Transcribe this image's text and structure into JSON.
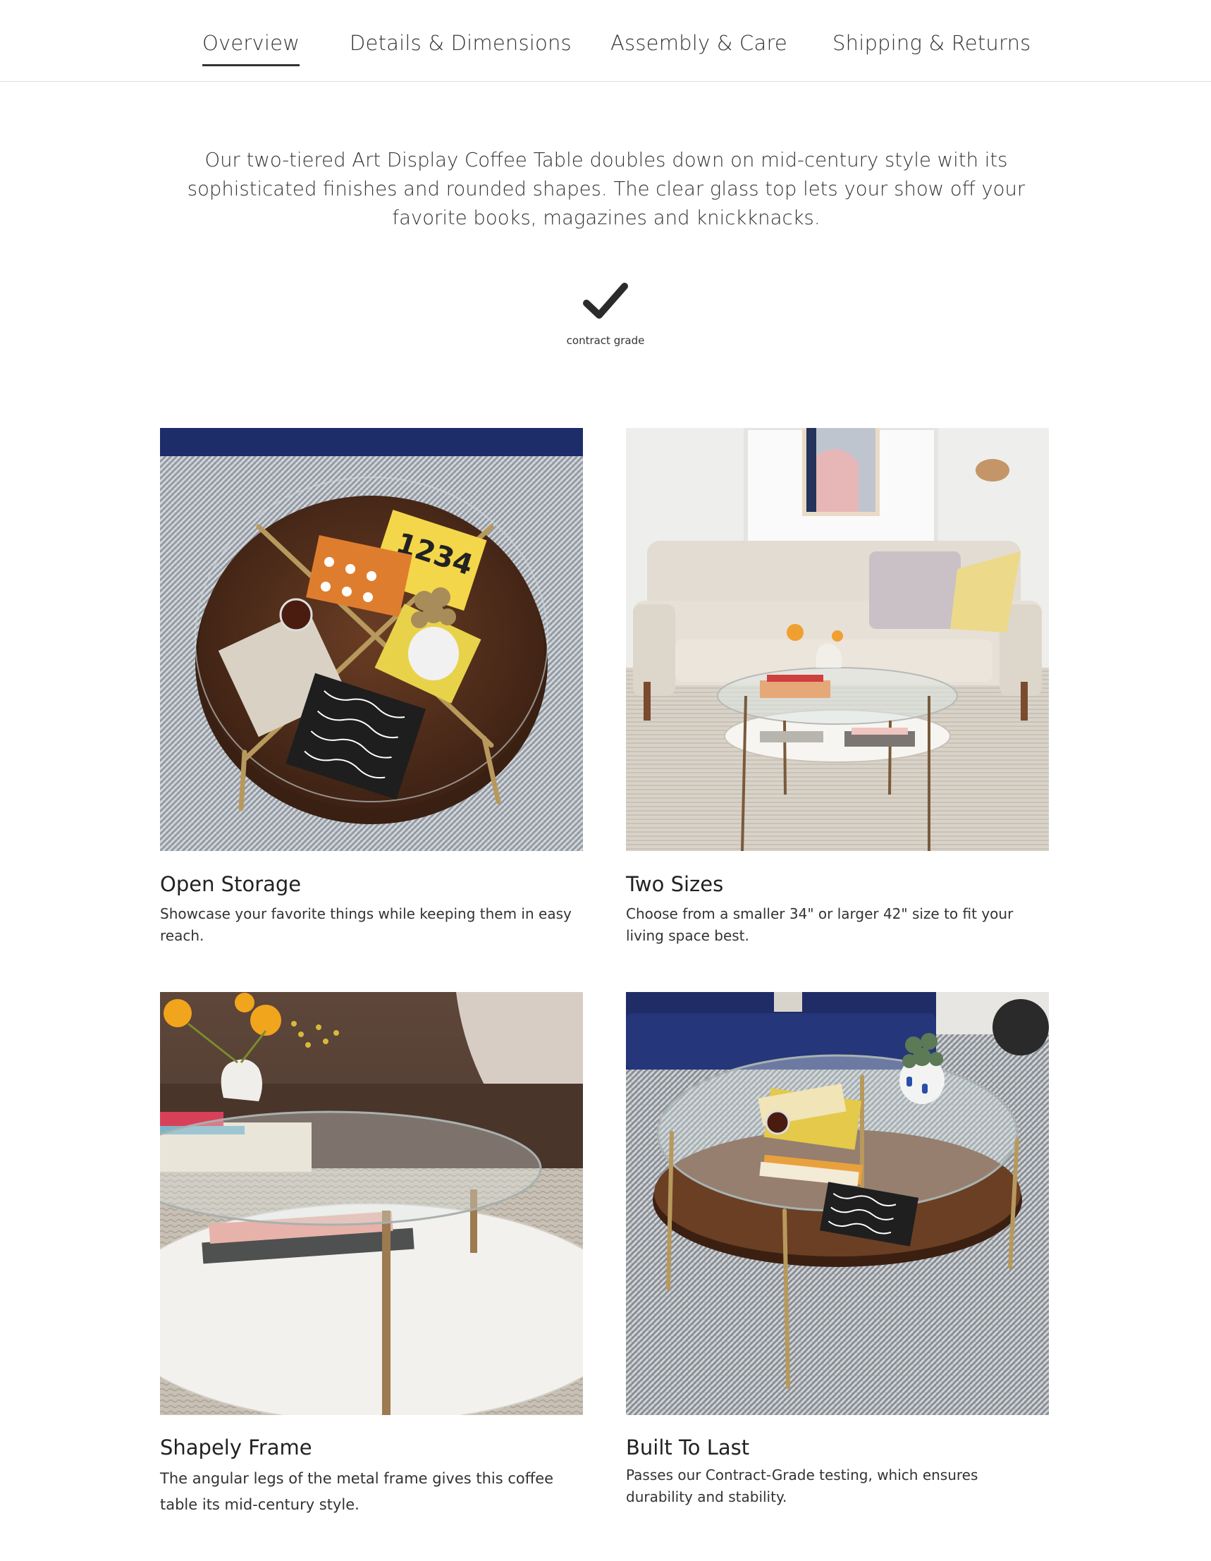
{
  "tabs": [
    {
      "label": "Overview",
      "active": true
    },
    {
      "label": "Details & Dimensions",
      "active": false
    },
    {
      "label": "Assembly & Care",
      "active": false
    },
    {
      "label": "Shipping & Returns",
      "active": false
    }
  ],
  "intro": {
    "text": "Our two-tiered Art Display Coffee Table doubles down on mid-century style with its sophisticated finishes and rounded shapes. The clear glass top lets your show off your favorite books, magazines and knickknacks."
  },
  "badge": {
    "icon": "checkmark-icon",
    "label": "contract grade"
  },
  "features": [
    {
      "title": "Open Storage",
      "description": "Showcase your favorite things while keeping them in easy reach.",
      "image": "coffee-table-top-view-photo"
    },
    {
      "title": "Two Sizes",
      "description": "Choose from a smaller 34\" or larger 42\" size to fit your living space best.",
      "image": "living-room-sofa-photo"
    },
    {
      "title": "Shapely Frame",
      "description": "The angular legs of the metal frame gives this coffee table its mid-century style.",
      "image": "frame-closeup-photo"
    },
    {
      "title": "Built To Last",
      "description": "Passes our Contract-Grade testing, which ensures durability and stability.",
      "image": "table-on-rug-photo"
    }
  ],
  "colors": {
    "text": "#333333",
    "divider": "#dcdcdc",
    "walnut": "#5a3420",
    "brass": "#b0925a"
  }
}
